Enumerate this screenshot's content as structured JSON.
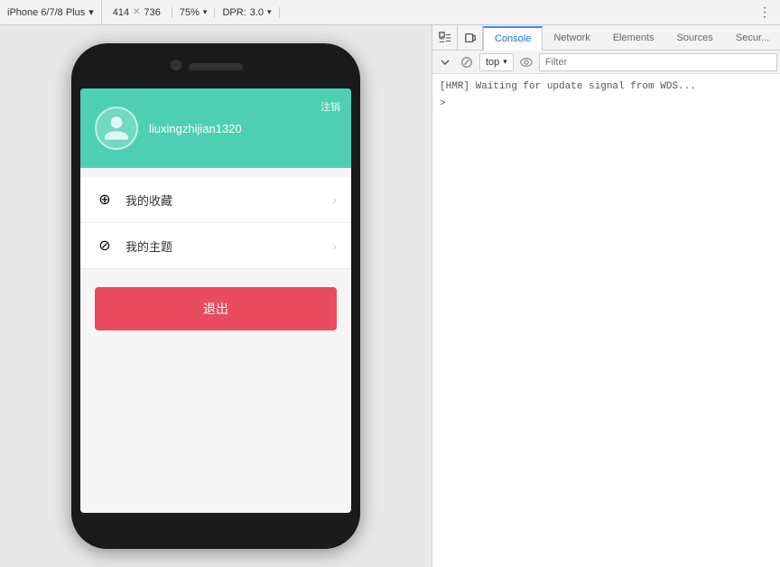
{
  "toolbar": {
    "device_name": "iPhone 6/7/8 Plus",
    "device_arrow": "▾",
    "width": "414",
    "cross": "✕",
    "height": "736",
    "zoom": "75%",
    "zoom_arrow": "▾",
    "dpr_label": "DPR:",
    "dpr_value": "3.0",
    "dpr_arrow": "▾",
    "more_icon": "⋮"
  },
  "devtools": {
    "tabs": [
      {
        "label": "Console",
        "active": true
      },
      {
        "label": "Network",
        "active": false
      },
      {
        "label": "Elements",
        "active": false
      },
      {
        "label": "Sources",
        "active": false
      },
      {
        "label": "Secur...",
        "active": false
      }
    ],
    "inspect_icon": "⬚",
    "device_icon": "⬚",
    "console": {
      "clear_icon": "🚫",
      "context": "top",
      "context_arrow": "▾",
      "eye_icon": "👁",
      "filter_placeholder": "Filter",
      "output_lines": [
        "[HMR] Waiting for update signal from WDS..."
      ],
      "prompt": ">"
    }
  },
  "phone": {
    "header_bg": "#4ecfb3",
    "username": "liuxingzhijian1320",
    "logout_link": "注销",
    "menu_items": [
      {
        "icon": "⊕",
        "label": "我的收藏"
      },
      {
        "icon": "⊘",
        "label": "我的主题"
      }
    ],
    "logout_btn_label": "退出",
    "logout_btn_bg": "#e94c5e"
  }
}
